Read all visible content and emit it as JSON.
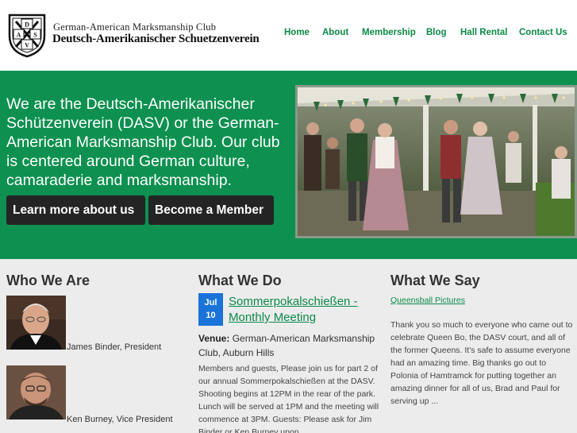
{
  "header": {
    "club_name_en": "German-American Marksmanship Club",
    "club_name_de": "Deutsch-Amerikanischer Schuetzenverein",
    "logo_letters": [
      "D",
      "A",
      "S",
      "V"
    ]
  },
  "nav": {
    "items": [
      {
        "label": "Home"
      },
      {
        "label": "About"
      },
      {
        "label": "Membership"
      },
      {
        "label": "Blog"
      },
      {
        "label": "Hall Rental"
      },
      {
        "label": "Contact Us"
      }
    ]
  },
  "hero": {
    "text": "We are the Deutsch-Amerikanischer Schützenverein (DASV) or the German-American Marksmanship Club. Our club is centered around German culture, camaraderie and marksmanship.",
    "learn_button": "Learn more about us",
    "member_button": "Become a Member"
  },
  "who_we_are": {
    "title": "Who We Are",
    "people": [
      {
        "name": "James Binder, President"
      },
      {
        "name": "Ken Burney, Vice President"
      }
    ]
  },
  "what_we_do": {
    "title": "What We Do",
    "event": {
      "month": "Jul",
      "day": "10",
      "title": "Sommerpokalschießen - Monthly Meeting",
      "venue_label": "Venue:",
      "venue": "German-American Marksmanship Club, Auburn Hills",
      "description": "Members and guests, Please join us for part 2 of our annual Sommerpokalschießen at the DASV. Shooting begins at 12PM in the rear of the park. Lunch will be served at 1PM and the meeting will commence at 3PM. Guests: Please ask for Jim Binder or Ken Burney upon"
    }
  },
  "what_we_say": {
    "title": "What We Say",
    "link": "Queensball Pictures",
    "text": "Thank you so much to everyone who came out to celebrate Queen Bo, the DASV court, and all of the former Queens. It's safe to assume everyone had an amazing time. Big thanks go out to Polonia of Hamtramck for putting together an amazing dinner for all of us, Brad and Paul for serving up ..."
  },
  "colors": {
    "brand_green": "#0d9050",
    "link_green": "#0c8a49",
    "button_dark": "#242424",
    "date_blue": "#1a73d9",
    "lower_bg": "#ececec"
  }
}
